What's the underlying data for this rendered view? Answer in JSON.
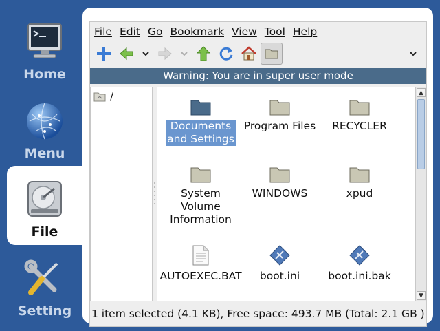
{
  "dock": {
    "items": [
      {
        "label": "Home",
        "icon": "monitor-terminal-icon"
      },
      {
        "label": "Menu",
        "icon": "globe-icon"
      },
      {
        "label": "File",
        "icon": "hard-drive-icon"
      },
      {
        "label": "Setting",
        "icon": "wrench-screwdriver-icon"
      }
    ],
    "active": "File"
  },
  "menubar": [
    "File",
    "Edit",
    "Go",
    "Bookmark",
    "View",
    "Tool",
    "Help"
  ],
  "toolbar": {
    "buttons": [
      "add-icon",
      "back-icon",
      "dropdown-icon",
      "forward-icon",
      "dropdown-icon",
      "up-icon",
      "refresh-icon",
      "home-icon",
      "folder-view-icon",
      "overflow-chevron-icon"
    ]
  },
  "warning": "Warning: You are in super user mode",
  "sidepane": {
    "path": "/"
  },
  "files": [
    {
      "name": "Documents and Settings",
      "line1": "Documents",
      "line2": "and Settings",
      "type": "folder",
      "selected": true
    },
    {
      "name": "Program Files",
      "line1": "Program Files",
      "line2": "",
      "type": "folder",
      "selected": false
    },
    {
      "name": "RECYCLER",
      "line1": "RECYCLER",
      "line2": "",
      "type": "folder",
      "selected": false
    },
    {
      "name": "System Volume Information",
      "line1": "System",
      "line2": "Volume",
      "line3": "Information",
      "type": "folder",
      "selected": false
    },
    {
      "name": "WINDOWS",
      "line1": "WINDOWS",
      "line2": "",
      "type": "folder",
      "selected": false
    },
    {
      "name": "xpud",
      "line1": "xpud",
      "line2": "",
      "type": "folder",
      "selected": false
    },
    {
      "name": "AUTOEXEC.BAT",
      "line1": "AUTOEXEC.BAT",
      "line2": "",
      "type": "text",
      "selected": false
    },
    {
      "name": "boot.ini",
      "line1": "boot.ini",
      "line2": "",
      "type": "config",
      "selected": false
    },
    {
      "name": "boot.ini.bak",
      "line1": "boot.ini.bak",
      "line2": "",
      "type": "config",
      "selected": false
    }
  ],
  "status": "1 item selected (4.1 KB), Free space: 493.7 MB (Total: 2.1 GB )",
  "colors": {
    "background": "#2d5a9a",
    "warning_bar": "#4a6b8a",
    "selection": "#6a96cf",
    "folder": "#c9c7b4"
  }
}
